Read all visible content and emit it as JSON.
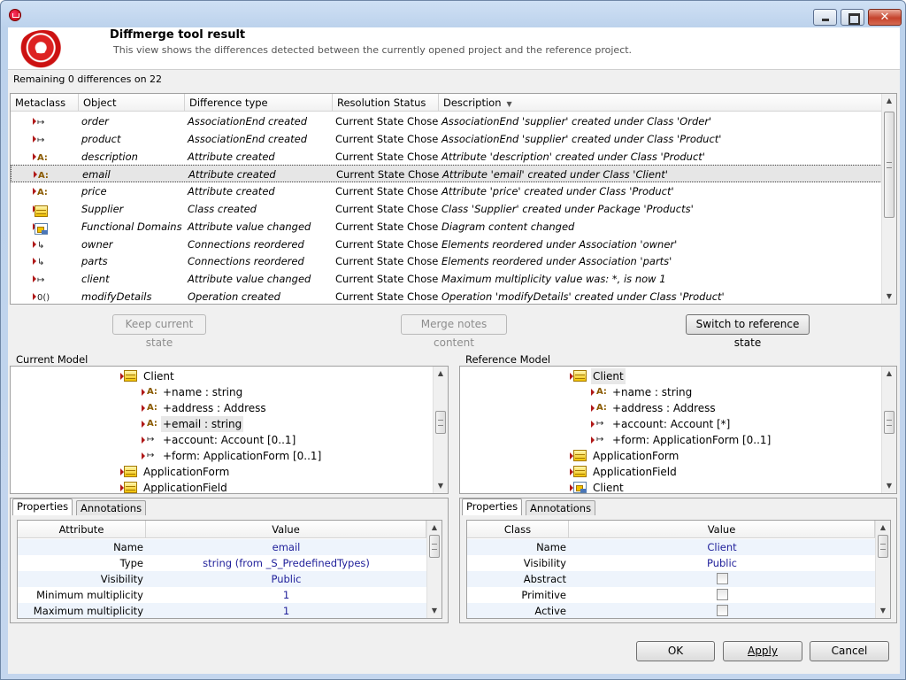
{
  "window": {
    "title": ""
  },
  "header": {
    "title": "Diffmerge tool result",
    "subtitle": "This view shows the differences detected between the currently opened project and the reference project."
  },
  "summary": "Remaining 0 differences on 22",
  "diff_table": {
    "columns": [
      "Metaclass",
      "Object",
      "Difference type",
      "Resolution Status",
      "Description"
    ],
    "rows": [
      {
        "icon": "association-end",
        "object": "order",
        "type": "AssociationEnd created",
        "status": "Current State Chosen",
        "description": "AssociationEnd 'supplier' created under Class 'Order'"
      },
      {
        "icon": "association-end",
        "object": "product",
        "type": "AssociationEnd created",
        "status": "Current State Chosen",
        "description": "AssociationEnd 'supplier' created under Class 'Product'"
      },
      {
        "icon": "attribute",
        "object": "description",
        "type": "Attribute created",
        "status": "Current State Chosen",
        "description": "Attribute 'description' created under Class 'Product'"
      },
      {
        "icon": "attribute",
        "object": "email",
        "type": "Attribute created",
        "status": "Current State Chosen",
        "description": "Attribute 'email' created under Class 'Client'",
        "selected": true
      },
      {
        "icon": "attribute",
        "object": "price",
        "type": "Attribute created",
        "status": "Current State Chosen",
        "description": "Attribute 'price' created under Class 'Product'"
      },
      {
        "icon": "class",
        "object": "Supplier",
        "type": "Class created",
        "status": "Current State Chosen",
        "description": "Class 'Supplier' created under Package 'Products'"
      },
      {
        "icon": "diagram",
        "object": "Functional Domains",
        "type": "Attribute value changed",
        "status": "Current State Chosen",
        "description": "Diagram content changed"
      },
      {
        "icon": "association",
        "object": "owner",
        "type": "Connections reordered",
        "status": "Current State Chosen",
        "description": "Elements reordered under Association 'owner'"
      },
      {
        "icon": "association",
        "object": "parts",
        "type": "Connections reordered",
        "status": "Current State Chosen",
        "description": "Elements reordered under Association 'parts'"
      },
      {
        "icon": "association-end",
        "object": "client",
        "type": "Attribute value changed",
        "status": "Current State Chosen",
        "description": "Maximum multiplicity value was: *, is now 1"
      },
      {
        "icon": "operation",
        "object": "modifyDetails",
        "type": "Operation created",
        "status": "Current State Chosen",
        "description": "Operation 'modifyDetails' created under Class 'Product'"
      }
    ]
  },
  "actions": {
    "keep": "Keep current state",
    "merge": "Merge notes content",
    "switch": "Switch to reference state"
  },
  "current_model": {
    "label": "Current Model",
    "nodes": [
      {
        "kind": "class",
        "label": "Client",
        "level": 0
      },
      {
        "kind": "attribute",
        "label": "+name : string",
        "level": 1
      },
      {
        "kind": "attribute",
        "label": "+address : Address",
        "level": 1
      },
      {
        "kind": "attribute",
        "label": "+email : string",
        "level": 1,
        "highlight": true
      },
      {
        "kind": "association-end",
        "label": "+account: Account [0..1]",
        "level": 1
      },
      {
        "kind": "association-end",
        "label": "+form: ApplicationForm [0..1]",
        "level": 1
      },
      {
        "kind": "class",
        "label": "ApplicationForm",
        "level": 0
      },
      {
        "kind": "class",
        "label": "ApplicationField",
        "level": 0
      }
    ]
  },
  "reference_model": {
    "label": "Reference Model",
    "nodes": [
      {
        "kind": "class",
        "label": "Client",
        "level": 0,
        "highlight": true
      },
      {
        "kind": "attribute",
        "label": "+name : string",
        "level": 1
      },
      {
        "kind": "attribute",
        "label": "+address : Address",
        "level": 1
      },
      {
        "kind": "association-end",
        "label": "+account: Account [*]",
        "level": 1
      },
      {
        "kind": "association-end",
        "label": "+form: ApplicationForm [0..1]",
        "level": 1
      },
      {
        "kind": "class",
        "label": "ApplicationForm",
        "level": 0
      },
      {
        "kind": "class",
        "label": "ApplicationField",
        "level": 0
      },
      {
        "kind": "diagram",
        "label": "Client",
        "level": 0
      }
    ]
  },
  "current_props": {
    "tabs": [
      "Properties",
      "Annotations"
    ],
    "columns": [
      "Attribute",
      "Value"
    ],
    "rows": [
      {
        "key": "Name",
        "value": "email"
      },
      {
        "key": "Type",
        "value": "string (from _S_PredefinedTypes)"
      },
      {
        "key": "Visibility",
        "value": "Public"
      },
      {
        "key": "Minimum multiplicity",
        "value": "1"
      },
      {
        "key": "Maximum multiplicity",
        "value": "1"
      }
    ]
  },
  "reference_props": {
    "tabs": [
      "Properties",
      "Annotations"
    ],
    "columns": [
      "Class",
      "Value"
    ],
    "rows": [
      {
        "key": "Name",
        "value": "Client"
      },
      {
        "key": "Visibility",
        "value": "Public"
      },
      {
        "key": "Abstract",
        "value": "",
        "checkbox": true,
        "checked": false
      },
      {
        "key": "Primitive",
        "value": "",
        "checkbox": true,
        "checked": false
      },
      {
        "key": "Active",
        "value": "",
        "checkbox": true,
        "checked": false
      }
    ]
  },
  "dialog_buttons": {
    "ok": "OK",
    "apply": "Apply",
    "cancel": "Cancel"
  }
}
